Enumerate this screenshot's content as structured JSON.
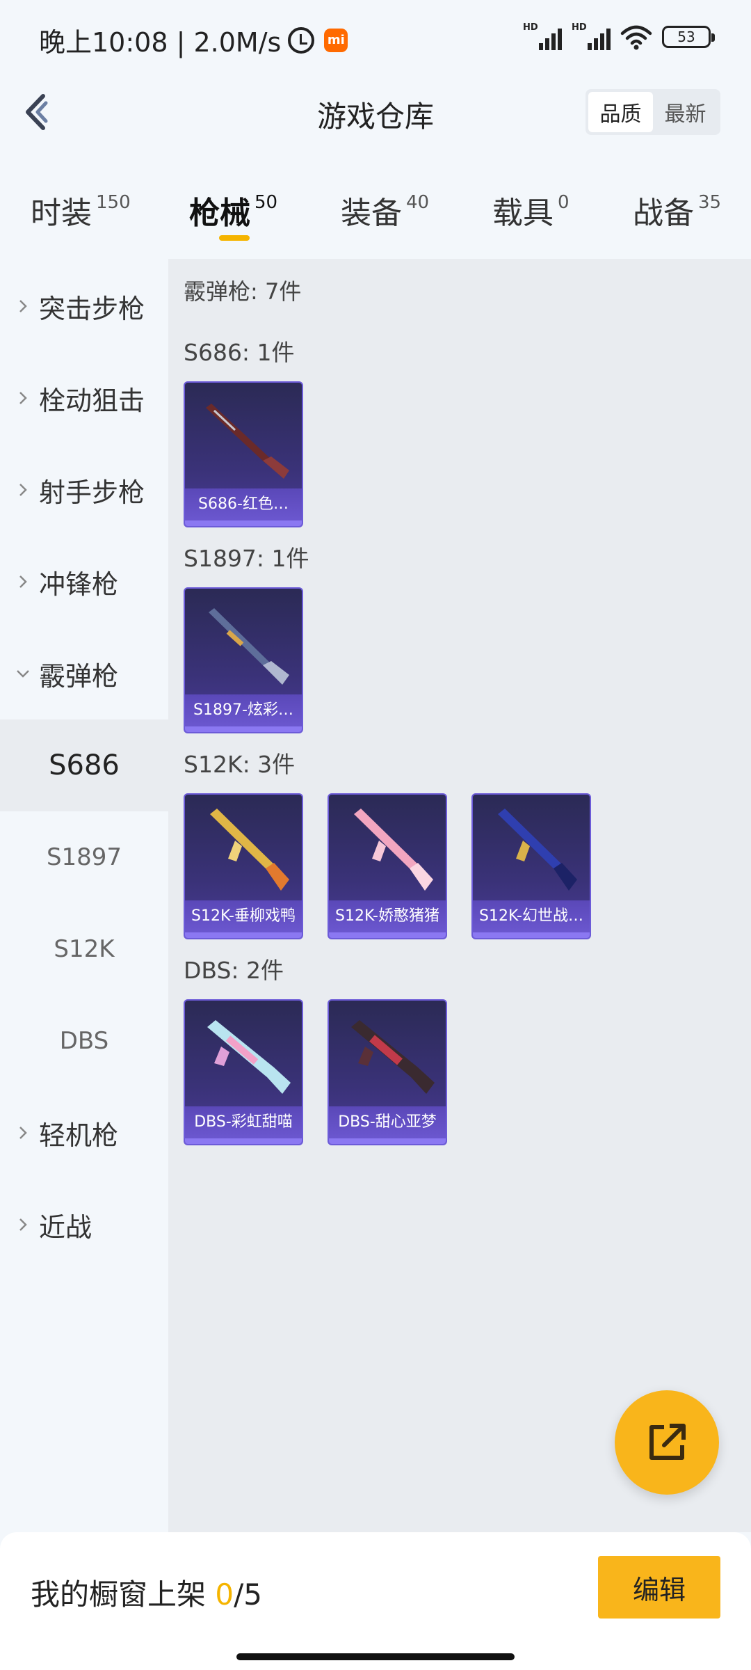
{
  "status": {
    "time": "晚上10:08 | 2.0M/s",
    "mi_badge": "mi",
    "network_label": "HD",
    "battery": "53"
  },
  "header": {
    "title": "游戏仓库",
    "sort_options": [
      "品质",
      "最新"
    ],
    "active_sort": "品质"
  },
  "tabs": [
    {
      "label": "时装",
      "count": "150"
    },
    {
      "label": "枪械",
      "count": "50"
    },
    {
      "label": "装备",
      "count": "40"
    },
    {
      "label": "载具",
      "count": "0"
    },
    {
      "label": "战备",
      "count": "35"
    }
  ],
  "active_tab": "枪械",
  "sidebar": {
    "categories": [
      {
        "label": "突击步枪",
        "expanded": false
      },
      {
        "label": "栓动狙击",
        "expanded": false
      },
      {
        "label": "射手步枪",
        "expanded": false
      },
      {
        "label": "冲锋枪",
        "expanded": false
      },
      {
        "label": "霰弹枪",
        "expanded": true
      },
      {
        "label": "轻机枪",
        "expanded": false
      },
      {
        "label": "近战",
        "expanded": false
      }
    ],
    "subitems": [
      "S686",
      "S1897",
      "S12K",
      "DBS"
    ],
    "active_subitem": "S686"
  },
  "content": {
    "category_title": "霰弹枪: 7件",
    "groups": [
      {
        "title": "S686: 1件",
        "items": [
          {
            "name": "S686-红色…",
            "icon": "shotgun-double-barrel-icon"
          }
        ]
      },
      {
        "title": "S1897: 1件",
        "items": [
          {
            "name": "S1897-炫彩…",
            "icon": "shotgun-pump-icon"
          }
        ]
      },
      {
        "title": "S12K: 3件",
        "items": [
          {
            "name": "S12K-垂柳戏鸭",
            "icon": "rifle-gold-icon"
          },
          {
            "name": "S12K-娇憨猪猪",
            "icon": "rifle-pink-icon"
          },
          {
            "name": "S12K-幻世战…",
            "icon": "rifle-blue-icon"
          }
        ]
      },
      {
        "title": "DBS: 2件",
        "items": [
          {
            "name": "DBS-彩虹甜喵",
            "icon": "bullpup-rainbow-icon"
          },
          {
            "name": "DBS-甜心亚梦",
            "icon": "bullpup-dark-icon"
          }
        ]
      }
    ]
  },
  "bottom": {
    "shelf_label": "我的橱窗上架 ",
    "shelf_used": "0",
    "shelf_total": "/5",
    "edit_label": "编辑"
  },
  "colors": {
    "accent": "#f9b51b",
    "card_border": "#6c5bd8",
    "card_bg": "#2b2a55"
  }
}
